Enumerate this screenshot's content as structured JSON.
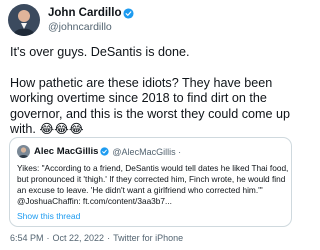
{
  "tweet": {
    "author": {
      "display_name": "John Cardillo",
      "handle": "@johncardillo",
      "verified": true,
      "avatar": "profile-photo"
    },
    "text_line1": "It's over guys. DeSantis is done.",
    "text_para2": "How pathetic are these idiots? They have been working overtime since 2018 to find dirt on the governor, and this is the worst they could come up with. 😂😂😂",
    "time": "6:54 PM",
    "date": "Oct 22, 2022",
    "client": "Twitter for iPhone",
    "separator": "·"
  },
  "quoted": {
    "author": {
      "display_name": "Alec MacGillis",
      "handle": "@AlecMacGillis",
      "verified": true,
      "separator": "·",
      "avatar": "profile-photo"
    },
    "text": "Yikes: \"According to a friend, DeSantis would tell dates he liked Thai food, but pronounced it 'thigh.' If they corrected him, Finch wrote, he would find an excuse to leave. 'He didn't want a girlfriend who corrected him.'\" @JoshuaChaffin: ft.com/content/3aa3b7...",
    "show_thread": "Show this thread"
  },
  "colors": {
    "text": "#0f1419",
    "secondary": "#536471",
    "link": "#1d9bf0",
    "verified": "#1d9bf0",
    "border": "#cfd9de"
  }
}
